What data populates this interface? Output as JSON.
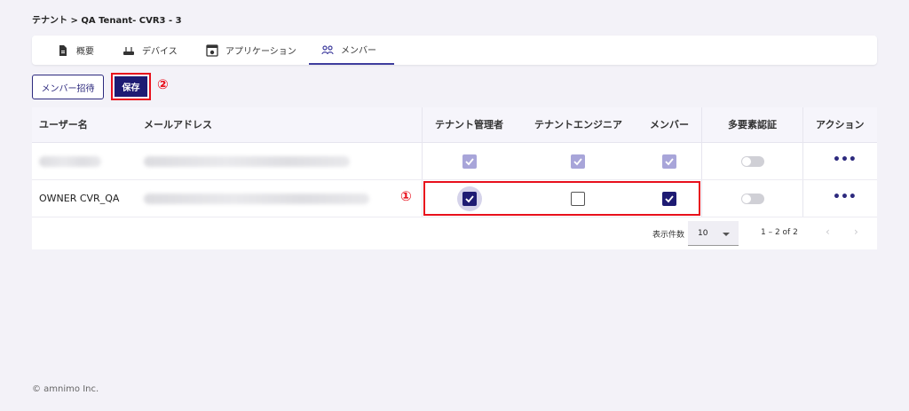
{
  "breadcrumb": "テナント > QA Tenant- CVR3 - 3",
  "tabs": [
    {
      "label": "概要",
      "icon": "document-icon"
    },
    {
      "label": "デバイス",
      "icon": "router-icon"
    },
    {
      "label": "アプリケーション",
      "icon": "app-window-icon"
    },
    {
      "label": "メンバー",
      "icon": "people-icon",
      "active": true
    }
  ],
  "toolbar": {
    "invite_label": "メンバー招待",
    "save_label": "保存"
  },
  "annotations": {
    "one": "①",
    "two": "②"
  },
  "table": {
    "columns": [
      "ユーザー名",
      "メールアドレス",
      "テナント管理者",
      "テナントエンジニア",
      "メンバー",
      "多要素認証",
      "アクション"
    ],
    "rows": [
      {
        "username": "",
        "email": "",
        "tenant_admin": true,
        "tenant_engineer": true,
        "member": true,
        "editable": false,
        "mfa": false,
        "actions": "•••"
      },
      {
        "username": "OWNER CVR_QA",
        "email": "",
        "tenant_admin": true,
        "tenant_engineer": false,
        "member": true,
        "editable": true,
        "mfa": false,
        "actions": "•••"
      }
    ]
  },
  "pagination": {
    "rows_per_page_label": "表示件数",
    "rows_per_page": "10",
    "range": "1 – 2 of 2",
    "prev": "‹",
    "next": "›"
  },
  "footer": {
    "copyright": "© amnimo Inc."
  },
  "colors": {
    "primary": "#1e1b73",
    "disabled_check": "#a8a5d9",
    "annotation_red": "#e8101c",
    "background": "#f3f2f8"
  }
}
